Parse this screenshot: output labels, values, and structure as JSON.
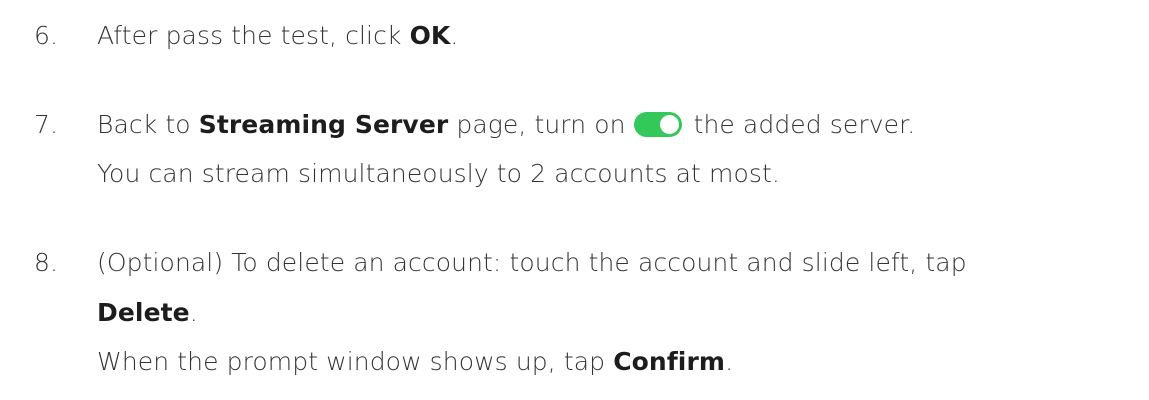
{
  "steps": [
    {
      "number": "6.",
      "parts": [
        "After pass the test, click ",
        "OK",
        "."
      ]
    },
    {
      "number": "7.",
      "parts": [
        "Back to ",
        "Streaming Server",
        " page, turn on",
        "the added server."
      ],
      "note": "You can stream simultaneously to 2 accounts at most."
    },
    {
      "number": "8.",
      "line1": "(Optional) To delete an account: touch the account and slide left, tap",
      "delete_label": "Delete",
      "delete_suffix": ".",
      "note_parts": [
        "When the prompt window shows up, tap ",
        "Confirm",
        "."
      ]
    }
  ],
  "toggle": {
    "state": "on",
    "color": "#34c759",
    "icon": "toggle-switch-on-icon"
  }
}
